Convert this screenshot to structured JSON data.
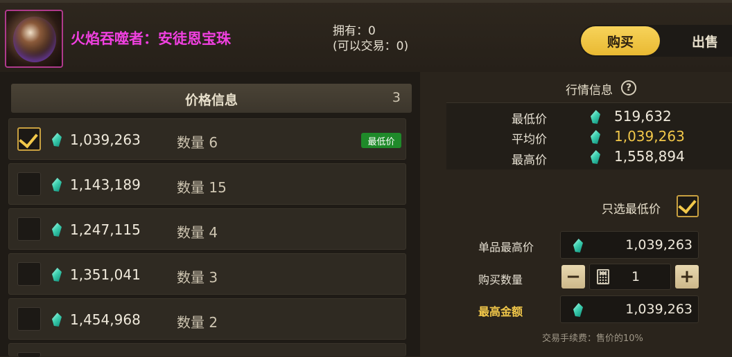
{
  "item": {
    "name": "火焰吞噬者：安徒恩宝珠",
    "owned": "拥有：0",
    "tradable": "(可以交易：0)",
    "icon": "orb-icon"
  },
  "tabs": {
    "buy": "购买",
    "sell": "出售"
  },
  "price_list": {
    "title": "价格信息",
    "count": "3",
    "badge": "最低价",
    "rows": [
      {
        "price": "1,039,263",
        "qty": "数量 6",
        "checked": true
      },
      {
        "price": "1,143,189",
        "qty": "数量 15",
        "checked": false
      },
      {
        "price": "1,247,115",
        "qty": "数量 4",
        "checked": false
      },
      {
        "price": "1,351,041",
        "qty": "数量 3",
        "checked": false
      },
      {
        "price": "1,454,968",
        "qty": "数量 2",
        "checked": false
      }
    ]
  },
  "market": {
    "title": "行情信息",
    "help_icon": "?",
    "min_label": "最低价",
    "min_value": "519,632",
    "avg_label": "平均价",
    "avg_value": "1,039,263",
    "max_label": "最高价",
    "max_value": "1,558,894"
  },
  "buy_form": {
    "only_lowest": "只选最低价",
    "only_lowest_checked": true,
    "unit_max_label": "单品最高价",
    "unit_max_value": "1,039,263",
    "qty_label": "购买数量",
    "qty_value": "1",
    "total_label": "最高金额",
    "total_value": "1,039,263",
    "minus": "−",
    "plus": "+",
    "fee_note": "交易手续费：售价的10%"
  },
  "colors": {
    "accent_gold": "#f2c84a",
    "item_name": "#f040e0",
    "badge_green": "#1f8a2a"
  }
}
